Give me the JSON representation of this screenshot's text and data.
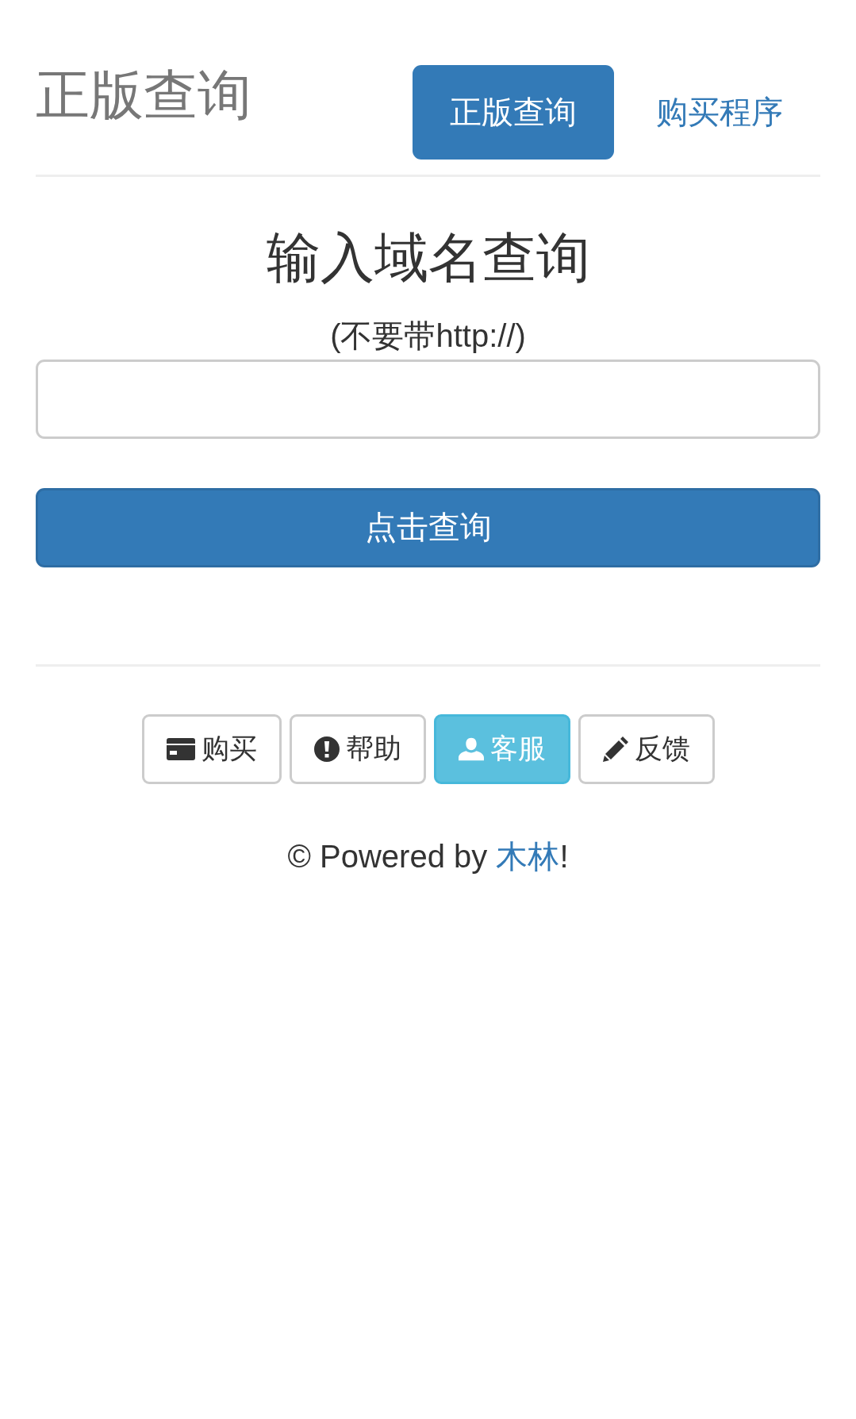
{
  "header": {
    "title": "正版查询",
    "nav": [
      {
        "label": "正版查询",
        "selected": true
      },
      {
        "label": "购买程序",
        "selected": false
      }
    ]
  },
  "query": {
    "heading": "输入域名查询",
    "hint": "(不要带http://)",
    "submit": "点击查询"
  },
  "actions": [
    {
      "kind": "card",
      "label": "购买",
      "selected": false
    },
    {
      "kind": "alert",
      "label": "帮助",
      "selected": false
    },
    {
      "kind": "user",
      "label": "客服",
      "selected": true
    },
    {
      "kind": "pencil",
      "label": "反馈",
      "selected": false
    }
  ],
  "footer": {
    "prefix": "© Powered by ",
    "link": "木林",
    "suffix": "!"
  }
}
